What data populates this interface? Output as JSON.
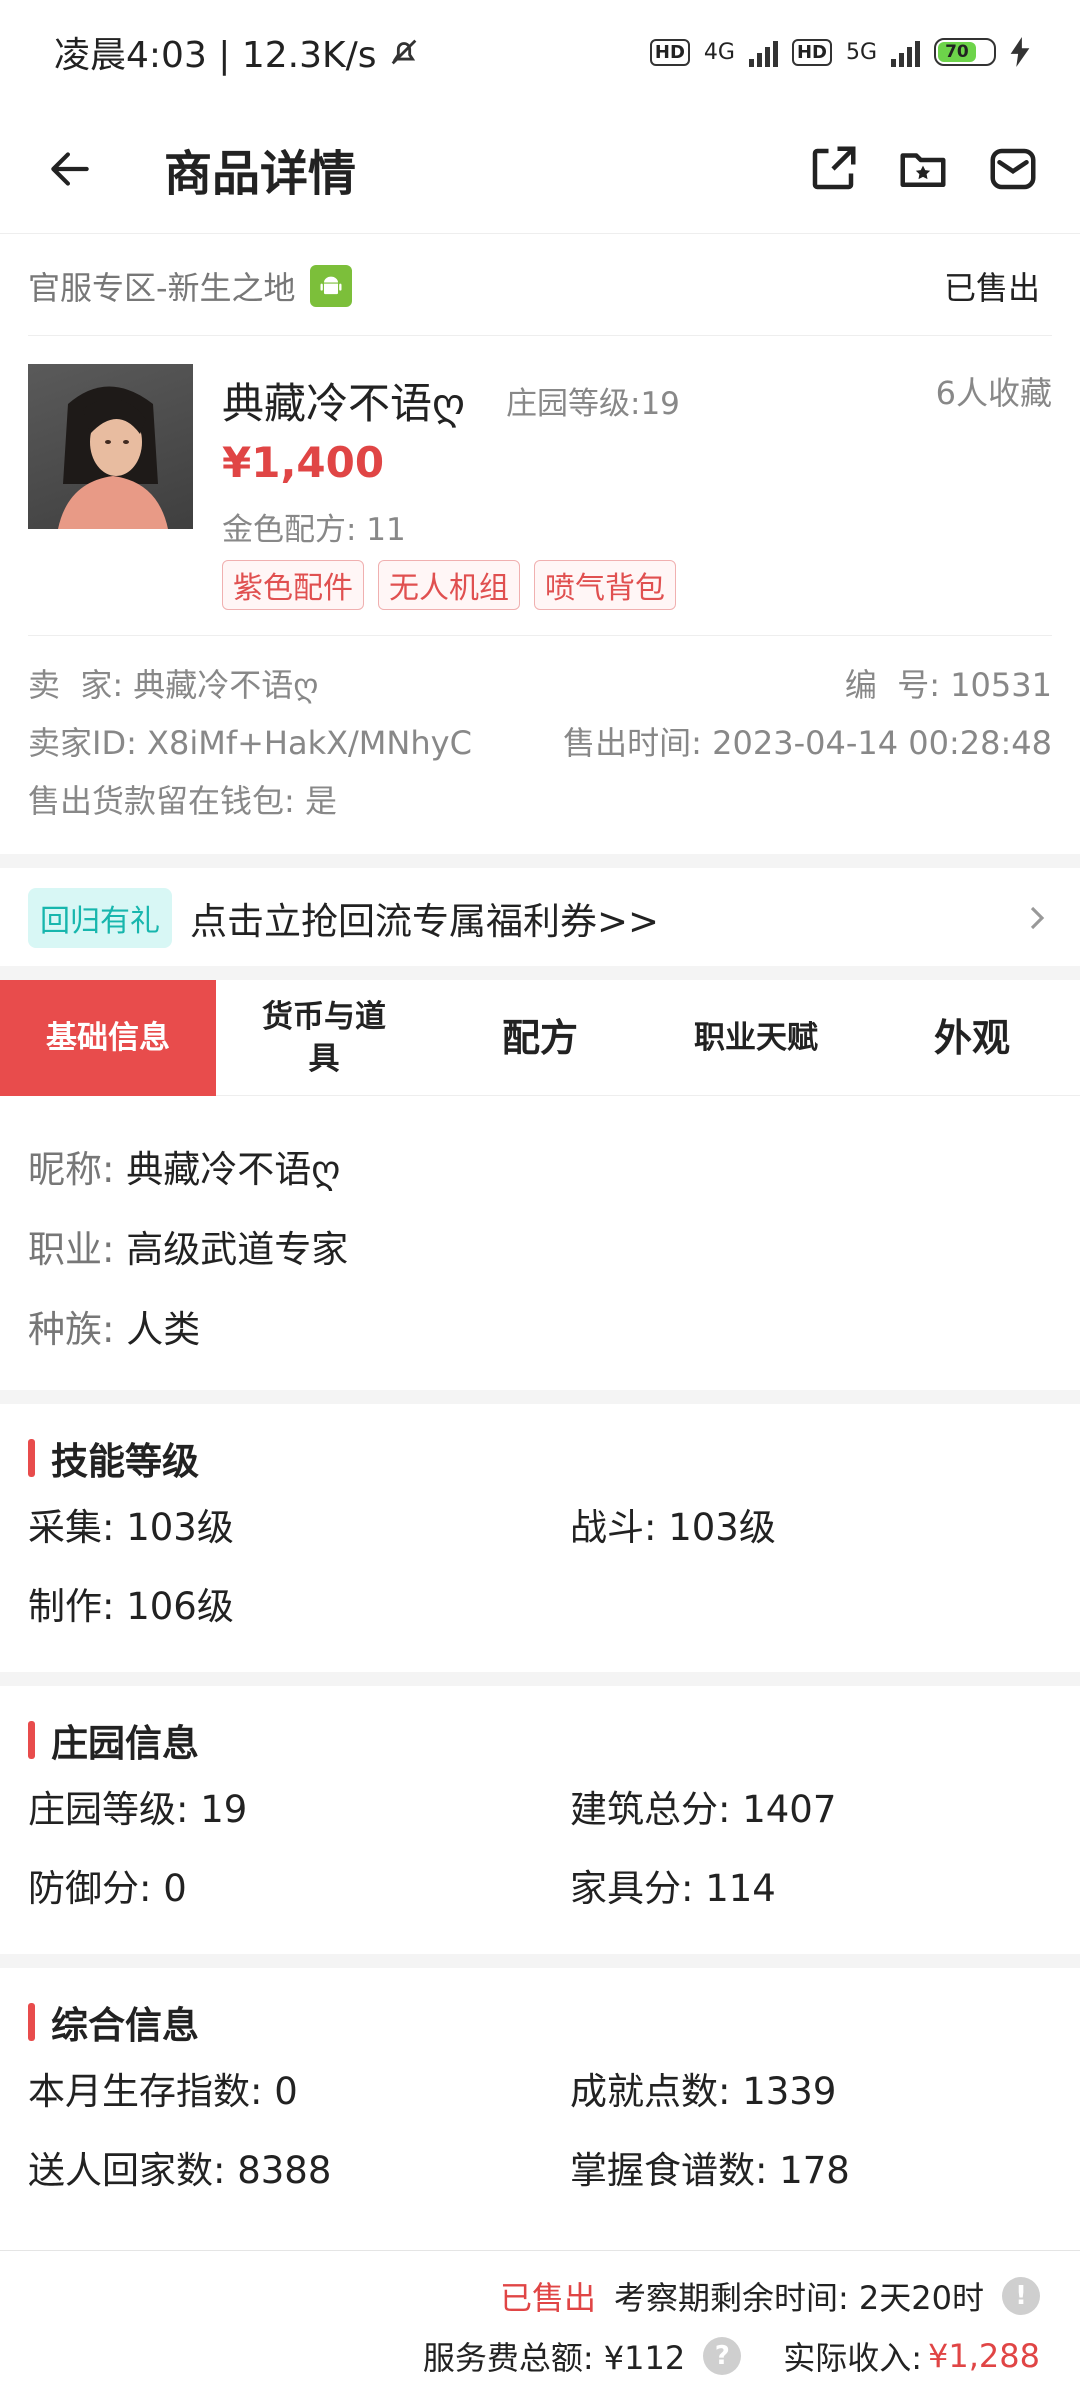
{
  "status_bar": {
    "time_speed": "凌晨4:03 | 12.3K/s",
    "net1": "4G",
    "net2": "5G",
    "battery": "70"
  },
  "header": {
    "title": "商品详情"
  },
  "server": {
    "name": "官服专区-新生之地",
    "status": "已售出"
  },
  "product": {
    "name": "典藏冷不语ღ",
    "estate_level": "庄园等级:19",
    "favorites": "6人收藏",
    "price": "¥1,400",
    "gold_recipe": "金色配方: 11",
    "tags": [
      "紫色配件",
      "无人机组",
      "喷气背包"
    ]
  },
  "seller": {
    "seller": "卖  家: 典藏冷不语ღ",
    "number": "编  号: 10531",
    "seller_id": "卖家ID: X8iMf+HakX/MNhyC",
    "sold_time": "售出时间: 2023-04-14 00:28:48",
    "wallet": "售出货款留在钱包: 是"
  },
  "promo": {
    "badge": "回归有礼",
    "text": "点击立抢回流专属福利券>>"
  },
  "tabs": [
    {
      "label": "基础信息"
    },
    {
      "label": "货币与道具"
    },
    {
      "label": "配方"
    },
    {
      "label": "职业天赋"
    },
    {
      "label": "外观"
    }
  ],
  "basic": {
    "nickname_label": "昵称:",
    "nickname": "典藏冷不语ღ",
    "job_label": "职业:",
    "job": "高级武道专家",
    "race_label": "种族:",
    "race": "人类"
  },
  "skills": {
    "title": "技能等级",
    "items": [
      "采集: 103级",
      "战斗: 103级",
      "制作: 106级"
    ]
  },
  "estate": {
    "title": "庄园信息",
    "items": [
      "庄园等级: 19",
      "建筑总分: 1407",
      "防御分: 0",
      "家具分: 114"
    ]
  },
  "overall": {
    "title": "综合信息",
    "items": [
      "本月生存指数: 0",
      "成就点数: 1339",
      "送人回家数: 8388",
      "掌握食谱数: 178"
    ]
  },
  "footer": {
    "sold": "已售出",
    "review_time": "考察期剩余时间: 2天20时",
    "fee": "服务费总额: ¥112",
    "income_label": "实际收入:",
    "income": "¥1,288"
  },
  "colors": {
    "accent": "#e84c4c",
    "promo": "#17b6ad"
  }
}
